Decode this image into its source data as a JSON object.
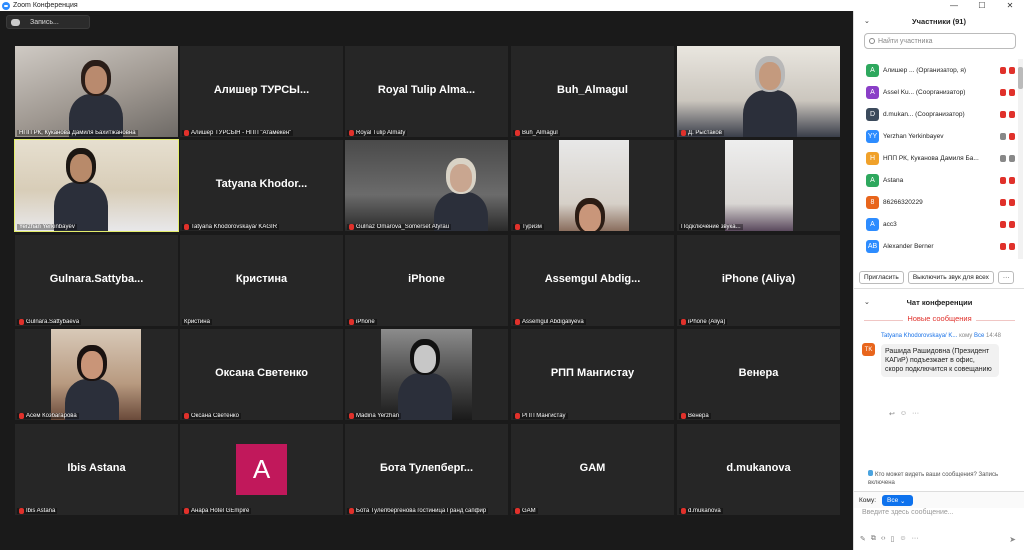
{
  "window": {
    "title": "Zoom Конференция",
    "min": "—",
    "max": "☐",
    "close": "✕"
  },
  "record": {
    "label": "Запись..."
  },
  "tiles": [
    {
      "kind": "photo",
      "label": "НПП РК, Куканова Дамиля Бахитжановна",
      "muted": false
    },
    {
      "kind": "name",
      "name": "Алишер ТУРСЫ...",
      "label": "Алишер ТУРСЫН - НПП \"Атамекен\"",
      "muted": true
    },
    {
      "kind": "name",
      "name": "Royal Tulip Alma...",
      "label": "Royal Tulip Almaty",
      "muted": true
    },
    {
      "kind": "name",
      "name": "Buh_Almagul",
      "label": "Buh_Almagul",
      "muted": true
    },
    {
      "kind": "photo",
      "label": "Д. Рыстаков",
      "muted": true
    },
    {
      "kind": "photo",
      "label": "Yerzhan Yerkinbayev",
      "muted": false
    },
    {
      "kind": "name",
      "name": "Tatyana Khodor...",
      "label": "Tatyana Khodorovskaya/ KAGIR",
      "muted": true
    },
    {
      "kind": "photo",
      "label": "Gulnaz Omarova_Somerset Atyrau",
      "muted": true
    },
    {
      "kind": "photo",
      "label": "Туризм",
      "muted": true
    },
    {
      "kind": "photo",
      "label": "Подключение звука...",
      "muted": false
    },
    {
      "kind": "name",
      "name": "Gulnara.Sattyba...",
      "label": "Gulnara.Sattybaeva",
      "muted": true
    },
    {
      "kind": "name",
      "name": "Кристина",
      "label": "Кристина",
      "muted": false
    },
    {
      "kind": "name",
      "name": "iPhone",
      "label": "iPhone",
      "muted": true
    },
    {
      "kind": "name",
      "name": "Assemgul Abdig...",
      "label": "Assemgul Abdigaliyeva",
      "muted": true
    },
    {
      "kind": "name",
      "name": "iPhone (Aliya)",
      "label": "iPhone (Aliya)",
      "muted": true
    },
    {
      "kind": "photo",
      "label": "Асем Козбагарова",
      "muted": true
    },
    {
      "kind": "name",
      "name": "Оксана Светенко",
      "label": "Оксана Светенко",
      "muted": true
    },
    {
      "kind": "photo",
      "label": "Madina Yerzhan",
      "muted": true
    },
    {
      "kind": "name",
      "name": "РПП Мангистау",
      "label": "РПП Мангистау",
      "muted": true
    },
    {
      "kind": "name",
      "name": "Венера",
      "label": "Венера",
      "muted": true
    },
    {
      "kind": "name",
      "name": "Ibis Astana",
      "label": "Ibis Astana",
      "muted": true
    },
    {
      "kind": "avatar",
      "letter": "A",
      "label": "Анара Hotel GEmpire",
      "muted": true
    },
    {
      "kind": "name",
      "name": "Бота Тулепберг...",
      "label": "Бота Тулепбергенова гостиница Гранд сапфир",
      "muted": true
    },
    {
      "kind": "name",
      "name": "GAM",
      "label": "GAM",
      "muted": true
    },
    {
      "kind": "name",
      "name": "d.mukanova",
      "label": "d.mukanova",
      "muted": true
    }
  ],
  "participants": {
    "title": "Участники (91)",
    "search_placeholder": "Найти участника",
    "list": [
      {
        "initials": "A",
        "color": "#2ea85e",
        "text": "Алишер ... (Организатор, я)"
      },
      {
        "initials": "A",
        "color": "#8a3fc7",
        "text": "Assel Ku... (Соорганизатор)"
      },
      {
        "initials": "D",
        "color": "#3b4a5c",
        "text": "d.mukan... (Соорганизатор)"
      },
      {
        "initials": "YY",
        "color": "#2d8cff",
        "text": "Yerzhan Yerkinbayev"
      },
      {
        "initials": "Н",
        "color": "#f0a12a",
        "text": "НПП РК, Куканова Дамиля Ба..."
      },
      {
        "initials": "A",
        "color": "#2ea85e",
        "text": "Astana"
      },
      {
        "initials": "8",
        "color": "#e8651c",
        "text": "86266320229"
      },
      {
        "initials": "A",
        "color": "#2d8cff",
        "text": "асс3"
      },
      {
        "initials": "AB",
        "color": "#2d8cff",
        "text": "Alexander Berner"
      }
    ],
    "invite": "Пригласить",
    "mute_all": "Выключить звук для всех",
    "more": "···"
  },
  "chat": {
    "title": "Чат конференции",
    "new_messages": "Новые сообщения",
    "message": {
      "avatar": "TK",
      "sender": "Tatyana Khodorovskaya/ K...",
      "to_label": "кому",
      "to": "Все",
      "time": "14:48",
      "text": "Рашида Рашидовна (Президент КАГиР) подъезжает в офис, скоро подключится к совещанию"
    },
    "who_can_see": "Кто может видеть ваши сообщения? Запись включена",
    "to_label": "Кому:",
    "to_value": "Все",
    "input_placeholder": "Введите здесь сообщение..."
  }
}
